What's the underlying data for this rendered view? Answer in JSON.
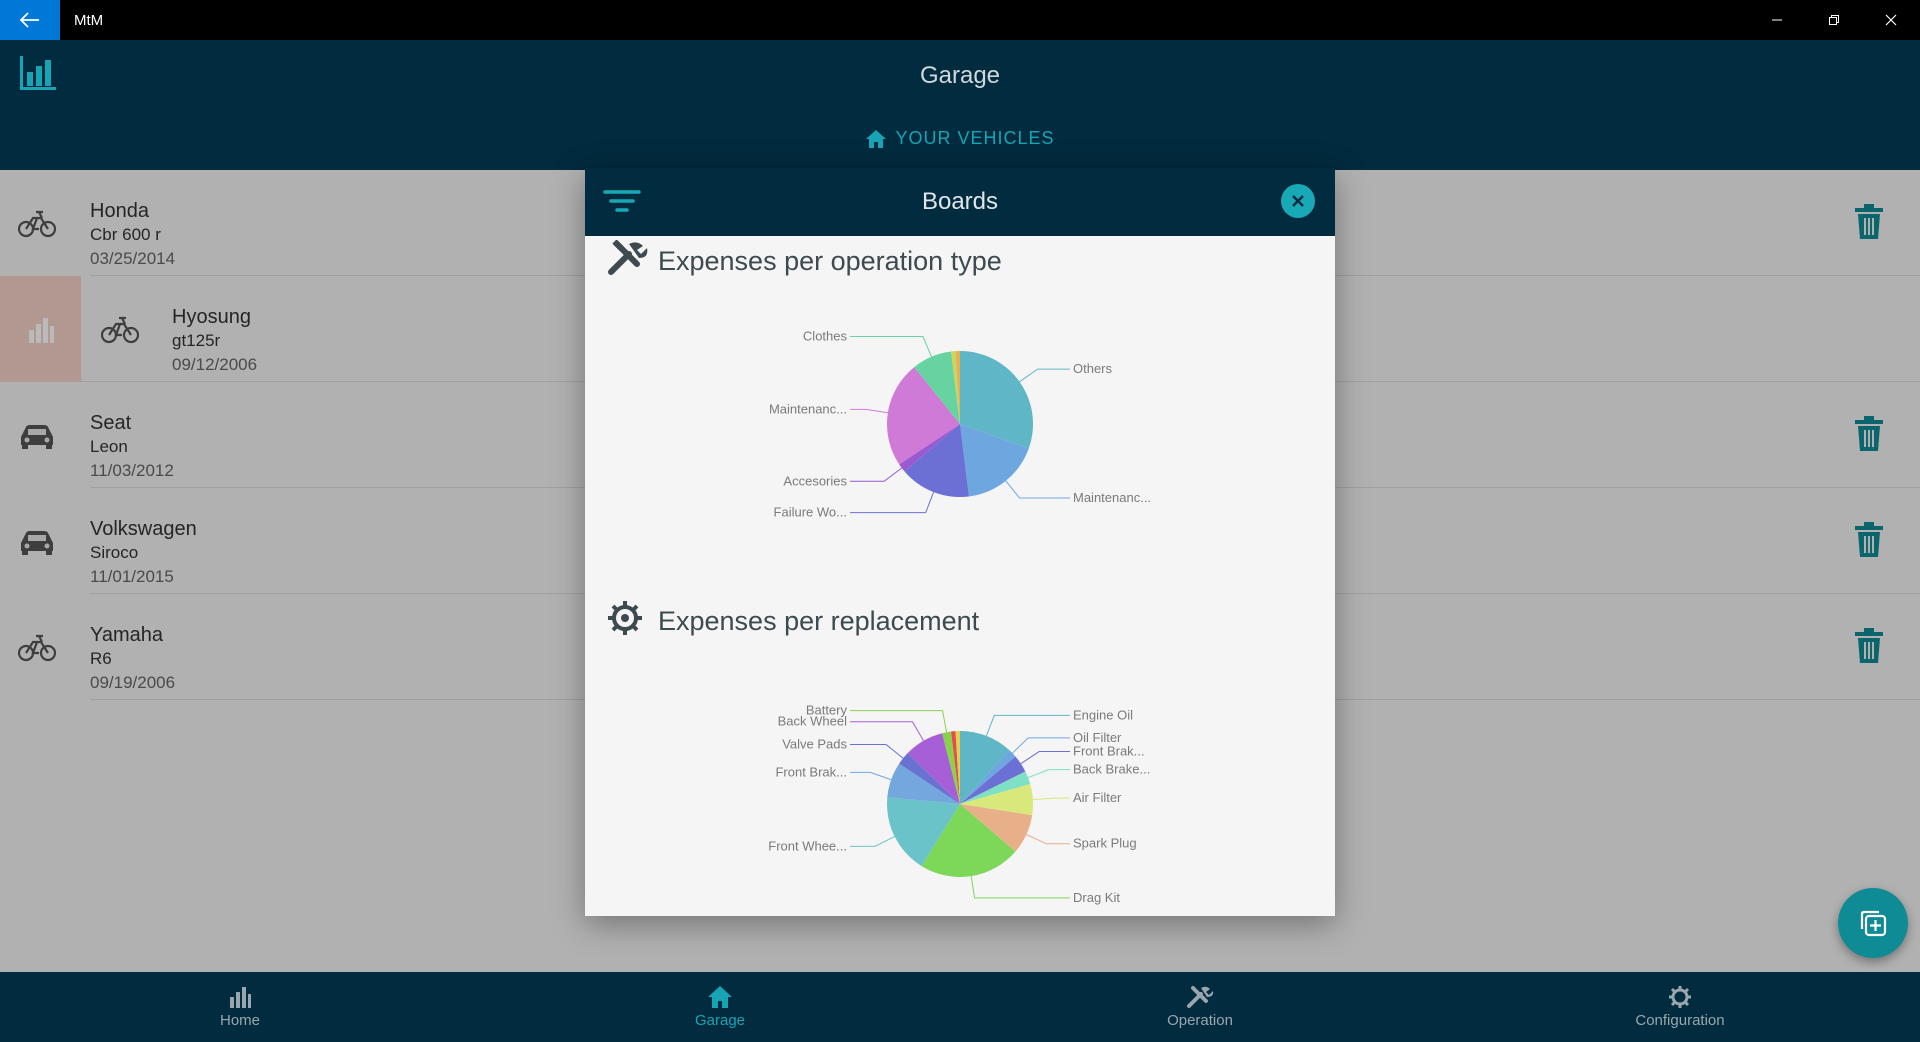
{
  "window": {
    "title": "MtM"
  },
  "header": {
    "title": "Garage",
    "subtitle": "YOUR VEHICLES"
  },
  "vehicles": [
    {
      "make": "Honda",
      "model": "Cbr 600 r",
      "date": "03/25/2014",
      "type": "motorbike"
    },
    {
      "make": "Hyosung",
      "model": "gt125r",
      "date": "09/12/2006",
      "type": "motorbike"
    },
    {
      "make": "Seat",
      "model": "Leon",
      "date": "11/03/2012",
      "type": "car"
    },
    {
      "make": "Volkswagen",
      "model": "Siroco",
      "date": "11/01/2015",
      "type": "car"
    },
    {
      "make": "Yamaha",
      "model": "R6",
      "date": "09/19/2006",
      "type": "motorbike"
    }
  ],
  "dialog": {
    "title": "Boards",
    "section1_title": "Expenses per operation type",
    "section2_title": "Expenses per replacement"
  },
  "chart_data": [
    {
      "type": "pie",
      "title": "Expenses per operation type",
      "labels": [
        "Others",
        "Maintenanc...",
        "Failure Wo...",
        "Accesories",
        "Maintenanc...",
        "Clothes"
      ],
      "values": [
        31,
        18,
        16,
        2,
        24,
        9
      ],
      "colors": [
        "#5fb6c6",
        "#6ea7e0",
        "#6c6fd4",
        "#9a5ad0",
        "#d07ad8",
        "#67d3a0"
      ],
      "extra_slices": [
        {
          "value": 1,
          "color": "#c9d463"
        },
        {
          "value": 1,
          "color": "#e8b04a"
        }
      ]
    },
    {
      "type": "pie",
      "title": "Expenses per replacement",
      "labels": [
        "Engine Oil",
        "Oil Filter",
        "Front Brak...",
        "Back Brake...",
        "Air Filter",
        "Spark Plug",
        "Drag Kit",
        "Front Whee...",
        "Front Brak...",
        "Valve Pads",
        "Back Wheel",
        "Battery"
      ],
      "values": [
        12,
        2,
        4,
        3,
        7,
        9,
        23,
        18,
        8,
        3,
        9,
        2
      ],
      "colors": [
        "#5fb6c6",
        "#6ea7e0",
        "#6c6fd4",
        "#7ee0c4",
        "#d9e87a",
        "#e8b088",
        "#7dd85a",
        "#69c3c9",
        "#74a7de",
        "#6a72d1",
        "#a75fd8",
        "#8bd24c"
      ],
      "extra_slices": [
        {
          "value": 1,
          "color": "#e04f4f"
        },
        {
          "value": 1,
          "color": "#e8d04a"
        }
      ]
    }
  ],
  "nav": [
    {
      "label": "Home",
      "icon": "bar-chart-icon"
    },
    {
      "label": "Garage",
      "icon": "house-icon"
    },
    {
      "label": "Operation",
      "icon": "tools-icon"
    },
    {
      "label": "Configuration",
      "icon": "gear-icon"
    }
  ],
  "colors": {
    "accent": "#17a5b5",
    "header_bg": "#012b3e"
  }
}
